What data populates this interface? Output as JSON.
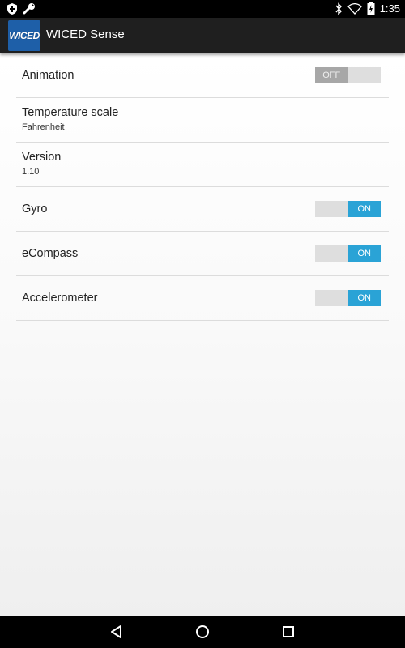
{
  "status_bar": {
    "time": "1:35",
    "icons": [
      "shield-icon",
      "wrench-icon",
      "bluetooth-icon",
      "wifi-icon",
      "battery-icon"
    ]
  },
  "app": {
    "logo_text": "WICED",
    "title": "WICED Sense"
  },
  "settings": {
    "animation": {
      "title": "Animation",
      "toggle": "OFF",
      "enabled": false
    },
    "temperature_scale": {
      "title": "Temperature scale",
      "summary": "Fahrenheit"
    },
    "version": {
      "title": "Version",
      "summary": "1.10"
    },
    "gyro": {
      "title": "Gyro",
      "toggle": "ON",
      "enabled": true
    },
    "ecompass": {
      "title": "eCompass",
      "toggle": "ON",
      "enabled": true
    },
    "accelerometer": {
      "title": "Accelerometer",
      "toggle": "ON",
      "enabled": true
    }
  },
  "nav_bar": {
    "icons": [
      "back-icon",
      "home-icon",
      "recents-icon"
    ]
  },
  "colors": {
    "toggle_on": "#2aa3d6",
    "toggle_off": "#a7a7a7",
    "action_bar": "#1f1f1f",
    "logo_bg": "#1e5fa8"
  }
}
